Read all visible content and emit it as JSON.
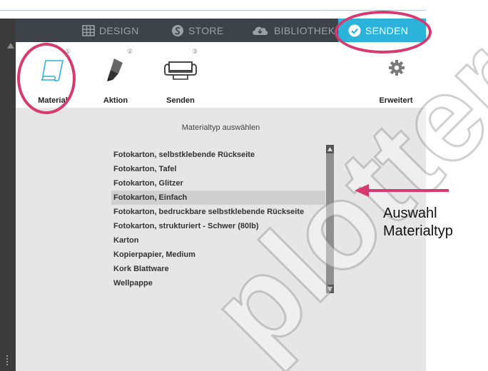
{
  "nav": {
    "tabs": [
      {
        "label": "DESIGN",
        "icon": "grid-icon",
        "active": false
      },
      {
        "label": "STORE",
        "icon": "s-logo-icon",
        "active": false
      },
      {
        "label": "BIBLIOTHEK",
        "icon": "cloud-download-icon",
        "active": false
      },
      {
        "label": "SENDEN",
        "icon": "checkmark-circle-icon",
        "active": true
      }
    ]
  },
  "steps": [
    {
      "number": "①",
      "label": "Material",
      "icon": "material-sheet-icon"
    },
    {
      "number": "②",
      "label": "Aktion",
      "icon": "pen-tool-icon"
    },
    {
      "number": "③",
      "label": "Senden",
      "icon": "cutter-roll-icon"
    }
  ],
  "advanced": {
    "label": "Erweitert",
    "icon": "gear-icon"
  },
  "panel": {
    "title": "Materialtyp auswählen",
    "materials": [
      "Fotokarton, selbstklebende Rückseite",
      "Fotokarton, Tafel",
      "Fotokarton, Glitzer",
      "Fotokarton, Einfach",
      "Fotokarton, bedruckbare selbstklebende Rückseite",
      "Fotokarton, strukturiert - Schwer (80lb)",
      "Karton",
      "Kopierpapier, Medium",
      "Kork Blattware",
      "Wellpappe"
    ],
    "selected_index": 3
  },
  "annotation": {
    "line1": "Auswahl",
    "line2": "Materialtyp"
  },
  "watermark": {
    "text": "plotter-vinyl.de"
  },
  "colors": {
    "accent": "#2bb3dc",
    "highlight": "#d63a6e",
    "navbar": "#3d4349",
    "panel": "#e6e6e6"
  }
}
